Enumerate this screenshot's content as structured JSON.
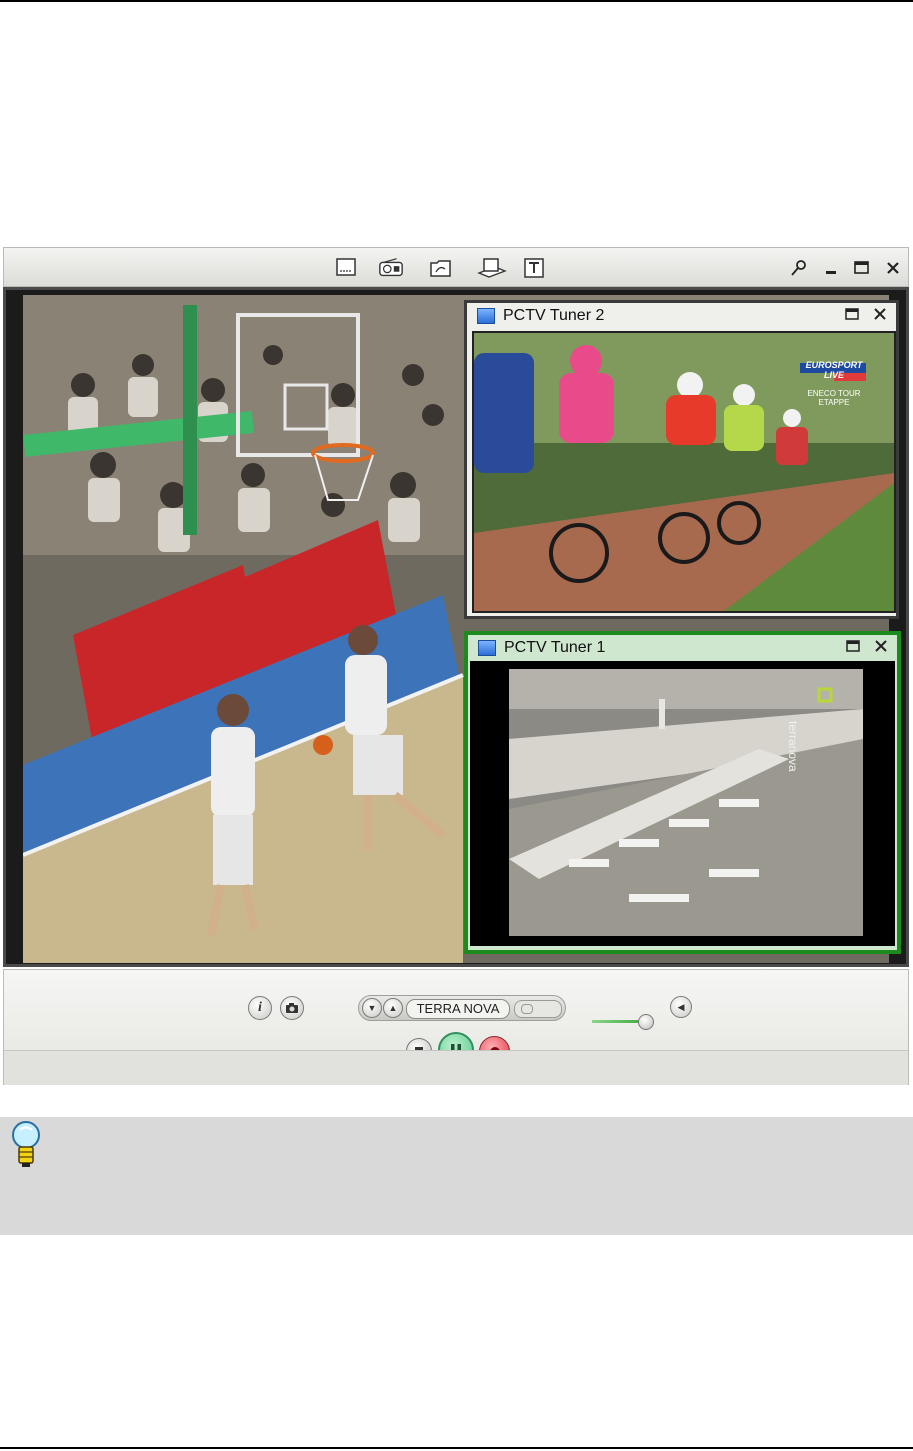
{
  "toolbar": {
    "icons": [
      "tv-mode-icon",
      "radio-mode-icon",
      "playback-folder-icon",
      "epg-icon",
      "teletext-icon"
    ]
  },
  "window_controls": [
    "pin-icon",
    "minimize-icon",
    "maximize-icon",
    "close-icon"
  ],
  "main_video": {
    "content": "basketball broadcast"
  },
  "pip_windows": [
    {
      "title": "PCTV Tuner 2",
      "active": false,
      "overlay_text": "EUROSPORT LIVE",
      "overlay_sub": "ENECO TOUR ETAPPE"
    },
    {
      "title": "PCTV  Tuner 1",
      "active": true,
      "overlay_text": "terranova"
    }
  ],
  "controls": {
    "channel_name": "TERRA NOVA",
    "volume_level": 0.8
  },
  "colors": {
    "active_border": "#1c8a1c",
    "inactive_border": "#3a3a3a",
    "play_button": "#58c98b",
    "record_button": "#e02d3a"
  },
  "tip": {
    "icon": "lightbulb-icon"
  }
}
